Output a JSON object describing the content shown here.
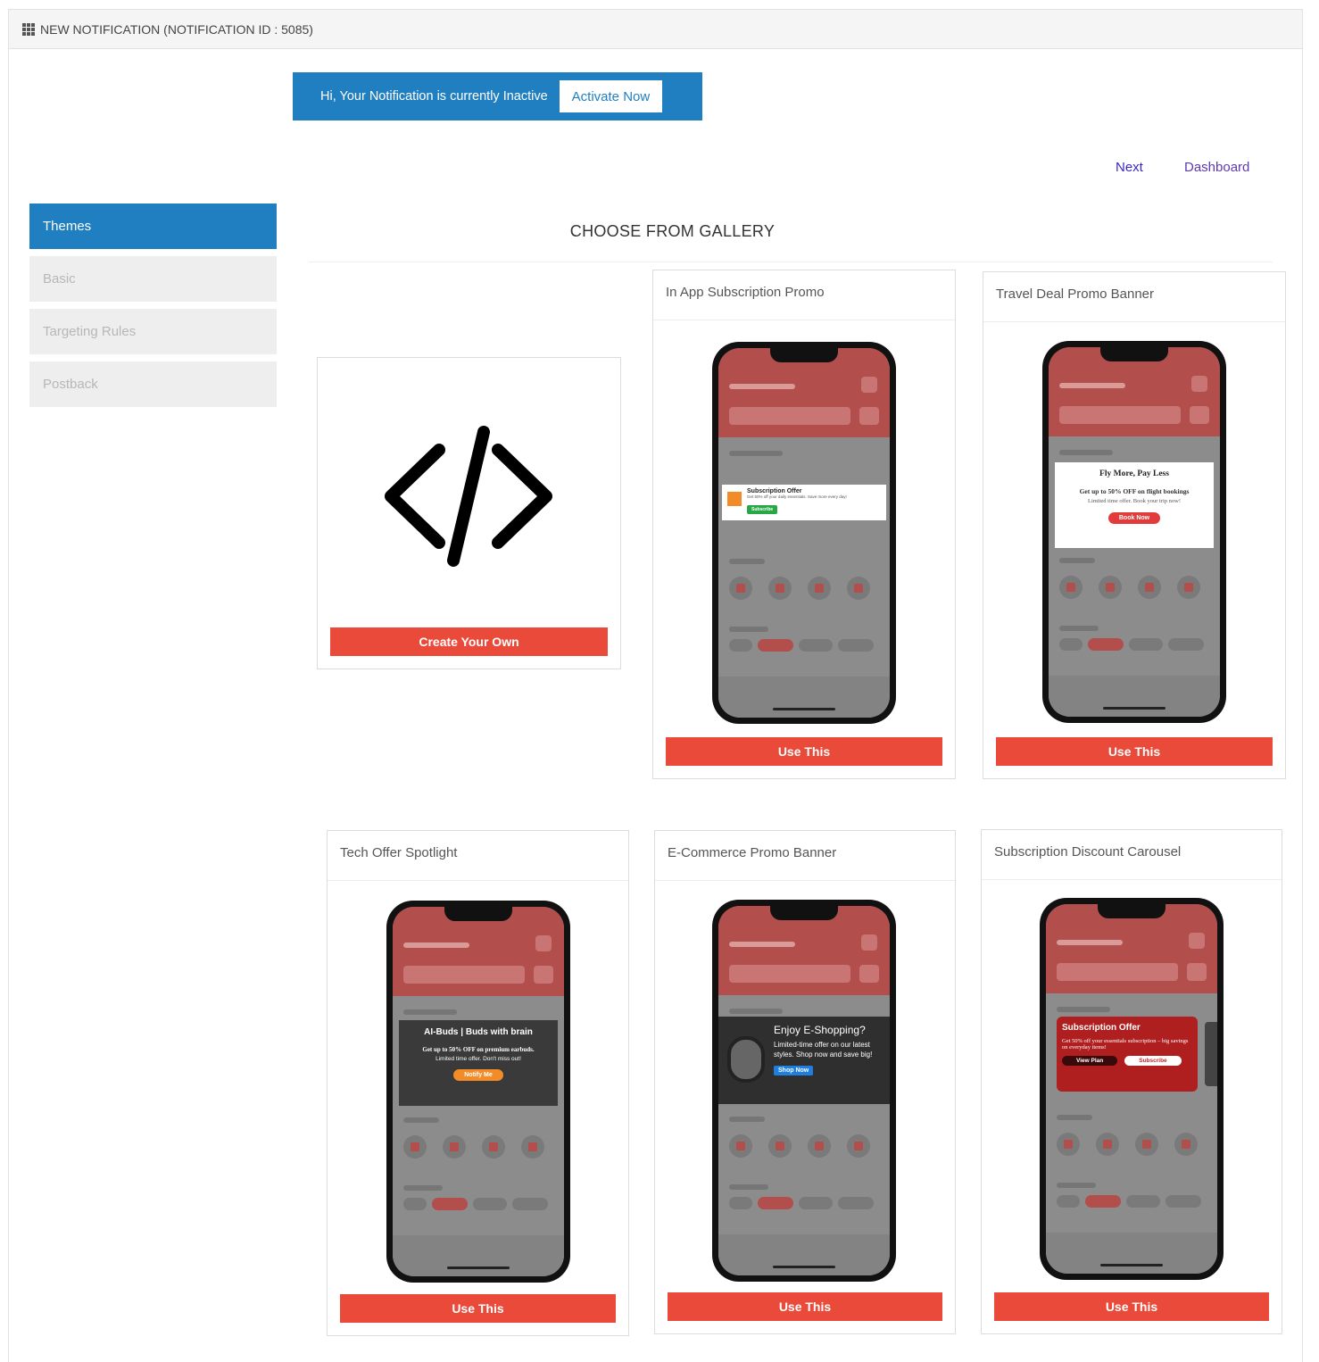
{
  "header": {
    "title": "NEW NOTIFICATION (NOTIFICATION ID : 5085)"
  },
  "banner": {
    "message": "Hi, Your Notification is currently Inactive",
    "activate_label": "Activate Now"
  },
  "nav": {
    "next": "Next",
    "dashboard": "Dashboard"
  },
  "sidebar": {
    "items": [
      {
        "label": "Themes"
      },
      {
        "label": "Basic"
      },
      {
        "label": "Targeting Rules"
      },
      {
        "label": "Postback"
      }
    ]
  },
  "gallery": {
    "title": "CHOOSE FROM GALLERY",
    "create_label": "Create Your Own",
    "use_label": "Use This",
    "templates": [
      {
        "name": "In App Subscription Promo",
        "popup_title": "Subscription Offer",
        "popup_text": "Get 50% off your daily essentials. Save more every day!",
        "popup_button": "Subscribe"
      },
      {
        "name": "Travel Deal Promo Banner",
        "popup_title": "Fly More, Pay Less",
        "popup_text": "Get up to 50% OFF on flight bookings",
        "popup_sub": "Limited time offer. Book your trip now!",
        "popup_button": "Book Now"
      },
      {
        "name": "Tech Offer Spotlight",
        "popup_title": "AI-Buds | Buds with brain",
        "popup_text": "Get up to 50% OFF on premium earbuds.",
        "popup_sub": "Limited time offer. Don't miss out!",
        "popup_button": "Notify Me"
      },
      {
        "name": "E-Commerce Promo Banner",
        "popup_title": "Enjoy E-Shopping?",
        "popup_text": "Limited-time offer on our latest styles. Shop now and save big!",
        "popup_button": "Shop Now"
      },
      {
        "name": "Subscription Discount Carousel",
        "popup_title": "Subscription Offer",
        "popup_text": "Get 50% off your essentials subscription – big savings on everyday items!",
        "popup_button": "Subscribe",
        "popup_button2": "View Plan"
      }
    ]
  },
  "colors": {
    "primary": "#1f7fc0",
    "accent": "#e94a3a"
  }
}
